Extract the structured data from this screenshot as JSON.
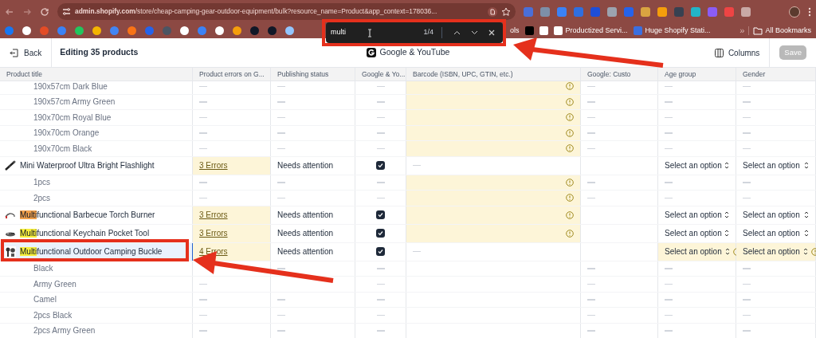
{
  "browser": {
    "url": "**admin.shopify.com**/store/cheap-camping-gear-outdoor-equipment/bulk?resource_name=Product&app_context=178036...",
    "bookmarks": [
      {
        "label": "ols"
      },
      {
        "label": "Productized Servi..."
      },
      {
        "label": "Huge Shopify Stati..."
      }
    ],
    "bookmarks_overflow": "»",
    "all_bookmarks": "All Bookmarks"
  },
  "find_bar": {
    "value": "multi",
    "count": "1/4"
  },
  "header": {
    "back": "Back",
    "title": "Editing 35 products",
    "channel": "Google & YouTube",
    "columns": "Columns",
    "save": {
      "label": "Save",
      "disabled": true
    }
  },
  "table": {
    "title_column": "Product title",
    "columns": [
      "Product errors on G...",
      "Publishing status",
      "Google & Yo...",
      "Barcode (ISBN, UPC, GTIN, etc.)",
      "Google: Custo",
      "Age group",
      "Gender"
    ],
    "rows": [
      {
        "kind": "variant",
        "title": "190x57cm Dark Blue",
        "selected": false,
        "cells": [
          {
            "kind": "dash",
            "error": false
          },
          {
            "kind": "dash",
            "error": false
          },
          {
            "kind": "dash",
            "error": false
          },
          {
            "kind": "blank",
            "error": true
          },
          {
            "kind": "dash",
            "error": false
          },
          {
            "kind": "dash",
            "error": false
          },
          {
            "kind": "dash",
            "error": false
          }
        ]
      },
      {
        "kind": "variant",
        "title": "190x57cm Army Green",
        "selected": false,
        "cells": [
          {
            "kind": "dash",
            "error": false
          },
          {
            "kind": "dash",
            "error": false
          },
          {
            "kind": "dash",
            "error": false
          },
          {
            "kind": "blank",
            "error": true
          },
          {
            "kind": "dash",
            "error": false
          },
          {
            "kind": "dash",
            "error": false
          },
          {
            "kind": "dash",
            "error": false
          }
        ]
      },
      {
        "kind": "variant",
        "title": "190x70cm Royal Blue",
        "selected": false,
        "cells": [
          {
            "kind": "dash",
            "error": false
          },
          {
            "kind": "dash",
            "error": false
          },
          {
            "kind": "dash",
            "error": false
          },
          {
            "kind": "blank",
            "error": true
          },
          {
            "kind": "dash",
            "error": false
          },
          {
            "kind": "dash",
            "error": false
          },
          {
            "kind": "dash",
            "error": false
          }
        ]
      },
      {
        "kind": "variant",
        "title": "190x70cm Orange",
        "selected": false,
        "cells": [
          {
            "kind": "dash",
            "error": false
          },
          {
            "kind": "dash",
            "error": false
          },
          {
            "kind": "dash",
            "error": false
          },
          {
            "kind": "blank",
            "error": true
          },
          {
            "kind": "dash",
            "error": false
          },
          {
            "kind": "dash",
            "error": false
          },
          {
            "kind": "dash",
            "error": false
          }
        ]
      },
      {
        "kind": "variant",
        "title": "190x70cm Black",
        "selected": false,
        "cells": [
          {
            "kind": "dash",
            "error": false
          },
          {
            "kind": "dash",
            "error": false
          },
          {
            "kind": "dash",
            "error": false
          },
          {
            "kind": "blank",
            "error": true
          },
          {
            "kind": "dash",
            "error": false
          },
          {
            "kind": "dash",
            "error": false
          },
          {
            "kind": "dash",
            "error": false
          }
        ]
      },
      {
        "kind": "product",
        "title": "Mini Waterproof Ultra Bright Flashlight",
        "selected": false,
        "cells": [
          {
            "kind": "link",
            "text": "3 Errors",
            "error": true
          },
          {
            "kind": "text",
            "text": "Needs attention",
            "error": false
          },
          {
            "kind": "checkbox",
            "checked": true,
            "error": false
          },
          {
            "kind": "dash",
            "error": false
          },
          {
            "kind": "blank",
            "error": false
          },
          {
            "kind": "select",
            "text": "Select an option",
            "error": false
          },
          {
            "kind": "select",
            "text": "Select an option",
            "error": false
          }
        ]
      },
      {
        "kind": "variant",
        "title": "1pcs",
        "selected": false,
        "cells": [
          {
            "kind": "dash",
            "error": false
          },
          {
            "kind": "dash",
            "error": false
          },
          {
            "kind": "dash",
            "error": false
          },
          {
            "kind": "blank",
            "error": true
          },
          {
            "kind": "dash",
            "error": false
          },
          {
            "kind": "dash",
            "error": false
          },
          {
            "kind": "dash",
            "error": false
          }
        ]
      },
      {
        "kind": "variant",
        "title": "2pcs",
        "selected": false,
        "cells": [
          {
            "kind": "dash",
            "error": false
          },
          {
            "kind": "dash",
            "error": false
          },
          {
            "kind": "dash",
            "error": false
          },
          {
            "kind": "blank",
            "error": true
          },
          {
            "kind": "dash",
            "error": false
          },
          {
            "kind": "dash",
            "error": false
          },
          {
            "kind": "dash",
            "error": false
          }
        ]
      },
      {
        "kind": "product",
        "highlight": {
          "text": "Multi",
          "current": true
        },
        "title": "functional Barbecue Torch Burner",
        "selected": false,
        "cells": [
          {
            "kind": "link",
            "text": "3 Errors",
            "error": true
          },
          {
            "kind": "text",
            "text": "Needs attention",
            "error": false
          },
          {
            "kind": "checkbox",
            "checked": true,
            "error": false
          },
          {
            "kind": "blank",
            "error": true
          },
          {
            "kind": "blank",
            "error": false
          },
          {
            "kind": "select",
            "text": "Select an option",
            "error": false
          },
          {
            "kind": "select",
            "text": "Select an option",
            "error": false
          }
        ]
      },
      {
        "kind": "product",
        "highlight": {
          "text": "Multi",
          "current": false
        },
        "title": "functional Keychain Pocket Tool",
        "selected": false,
        "cells": [
          {
            "kind": "link",
            "text": "3 Errors",
            "error": true
          },
          {
            "kind": "text",
            "text": "Needs attention",
            "error": false
          },
          {
            "kind": "checkbox",
            "checked": true,
            "error": false
          },
          {
            "kind": "blank",
            "error": true
          },
          {
            "kind": "blank",
            "error": false
          },
          {
            "kind": "select",
            "text": "Select an option",
            "error": false
          },
          {
            "kind": "select",
            "text": "Select an option",
            "error": false
          }
        ]
      },
      {
        "kind": "product",
        "highlight": {
          "text": "Multi",
          "current": false
        },
        "title": "functional Outdoor Camping Buckle",
        "selected": true,
        "cells": [
          {
            "kind": "link",
            "text": "4 Errors",
            "error": true
          },
          {
            "kind": "text",
            "text": "Needs attention",
            "error": false
          },
          {
            "kind": "checkbox",
            "checked": true,
            "error": false
          },
          {
            "kind": "dash",
            "error": false
          },
          {
            "kind": "blank",
            "error": false
          },
          {
            "kind": "select",
            "text": "Select an option",
            "error": true
          },
          {
            "kind": "select",
            "text": "Select an option",
            "error": true
          }
        ]
      },
      {
        "kind": "variant",
        "title": "Black",
        "selected": false,
        "cells": [
          {
            "kind": "blank",
            "error": false
          },
          {
            "kind": "dash",
            "error": false
          },
          {
            "kind": "dash",
            "error": false
          },
          {
            "kind": "blank",
            "error": false
          },
          {
            "kind": "dash",
            "error": false
          },
          {
            "kind": "dash",
            "error": false
          },
          {
            "kind": "dash",
            "error": false
          }
        ]
      },
      {
        "kind": "variant",
        "title": "Army Green",
        "selected": false,
        "cells": [
          {
            "kind": "dash",
            "error": false
          },
          {
            "kind": "blank",
            "error": false
          },
          {
            "kind": "dash",
            "error": false
          },
          {
            "kind": "blank",
            "error": false
          },
          {
            "kind": "dash",
            "error": false
          },
          {
            "kind": "dash",
            "error": false
          },
          {
            "kind": "dash",
            "error": false
          }
        ]
      },
      {
        "kind": "variant",
        "title": "Camel",
        "selected": false,
        "cells": [
          {
            "kind": "dash",
            "error": false
          },
          {
            "kind": "dash",
            "error": false
          },
          {
            "kind": "dash",
            "error": false
          },
          {
            "kind": "blank",
            "error": false
          },
          {
            "kind": "dash",
            "error": false
          },
          {
            "kind": "dash",
            "error": false
          },
          {
            "kind": "dash",
            "error": false
          }
        ]
      },
      {
        "kind": "variant",
        "title": "2pcs Black",
        "selected": false,
        "cells": [
          {
            "kind": "dash",
            "error": false
          },
          {
            "kind": "dash",
            "error": false
          },
          {
            "kind": "dash",
            "error": false
          },
          {
            "kind": "blank",
            "error": false
          },
          {
            "kind": "dash",
            "error": false
          },
          {
            "kind": "dash",
            "error": false
          },
          {
            "kind": "dash",
            "error": false
          }
        ]
      },
      {
        "kind": "variant",
        "title": "2pcs Army Green",
        "selected": false,
        "cells": [
          {
            "kind": "dash",
            "error": false
          },
          {
            "kind": "dash",
            "error": false
          },
          {
            "kind": "dash",
            "error": false
          },
          {
            "kind": "blank",
            "error": false
          },
          {
            "kind": "dash",
            "error": false
          },
          {
            "kind": "dash",
            "error": false
          },
          {
            "kind": "dash",
            "error": false
          }
        ]
      }
    ]
  }
}
